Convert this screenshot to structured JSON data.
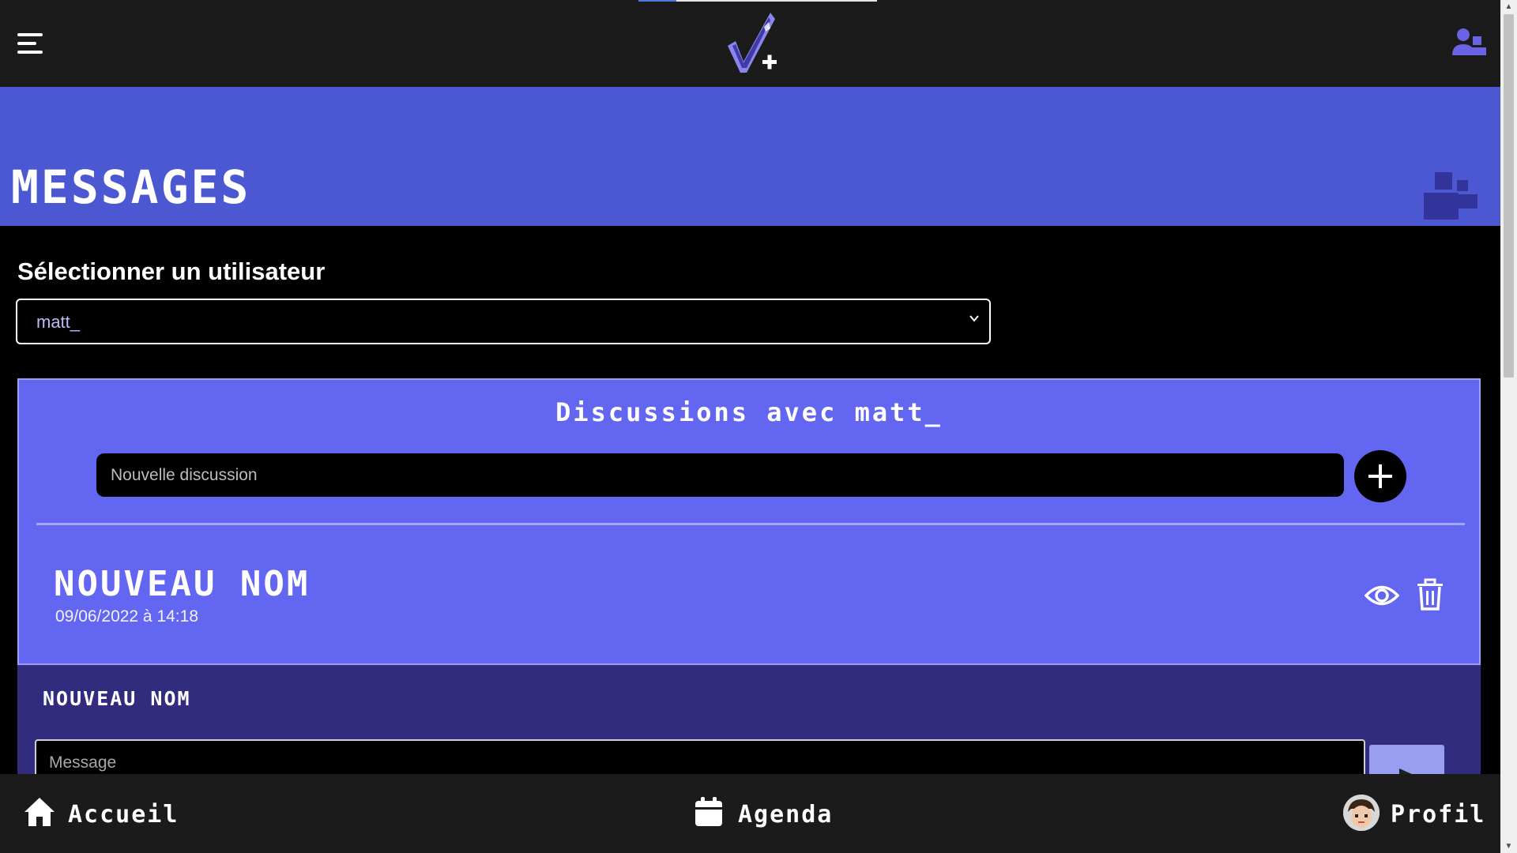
{
  "topbar": {
    "menu_icon": "hamburger-menu-icon",
    "logo_icon": "checkmark-plus-logo",
    "friends_icon": "friends-icon",
    "loading_progress": 0.16
  },
  "header": {
    "title": "MESSAGES",
    "icon": "friends-icon"
  },
  "user_select": {
    "label": "Sélectionner un utilisateur",
    "value": "matt_",
    "icon": "chevron-down-icon"
  },
  "discussions": {
    "title": "Discussions avec matt_",
    "new_placeholder": "Nouvelle discussion",
    "add_icon": "plus-icon",
    "items": [
      {
        "name": "NOUVEAU NOM",
        "date": "09/06/2022 à 14:18",
        "view_icon": "eye-icon",
        "delete_icon": "trash-icon"
      }
    ]
  },
  "conversation": {
    "title": "NOUVEAU NOM",
    "message_placeholder": "Message",
    "send_icon": "send-icon"
  },
  "bottom_nav": {
    "items": [
      {
        "label": "Accueil",
        "icon": "home-icon"
      },
      {
        "label": "Agenda",
        "icon": "calendar-icon"
      },
      {
        "label": "Profil",
        "icon": "avatar"
      }
    ]
  },
  "colors": {
    "bar_bg": "#1b1b1b",
    "banner": "#4b58d2",
    "panel": "#6366f1",
    "conversation": "#322c7f",
    "send_button": "#9a9ef0"
  }
}
